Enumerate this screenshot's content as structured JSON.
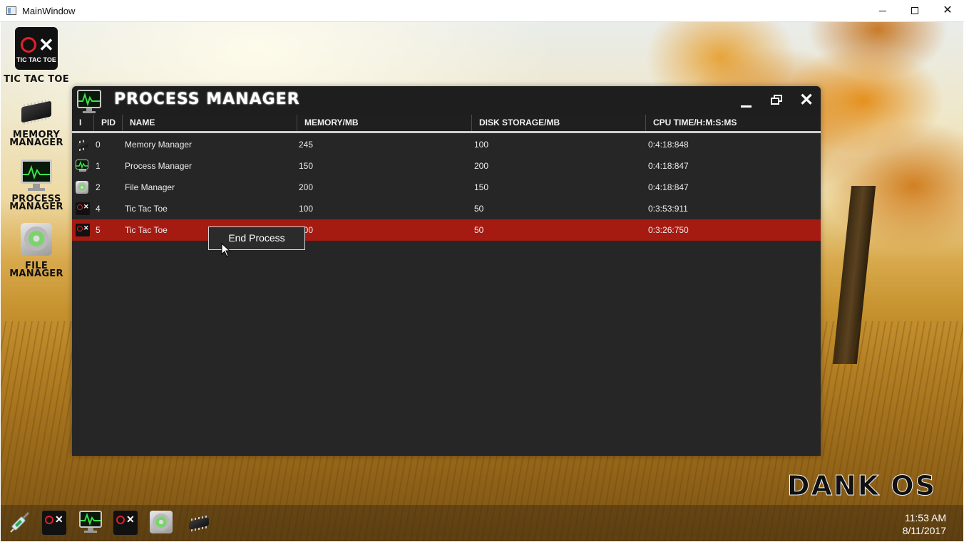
{
  "window": {
    "title": "MainWindow",
    "minimize": "",
    "maximize": "",
    "close": "✕"
  },
  "desktop_icons": {
    "tic_tac_toe": {
      "label": "Tic Tac Toe",
      "logo_text": "TIC TAC TOE"
    },
    "memory_manager": {
      "label_line1": "Memory",
      "label_line2": "Manager"
    },
    "process_manager": {
      "label_line1": "Process",
      "label_line2": "Manager"
    },
    "file_manager": {
      "label_line1": "File",
      "label_line2": "Manager"
    }
  },
  "process_manager": {
    "title": "PROCESS MANAGER",
    "close": "✕",
    "columns": [
      "I",
      "PID",
      "NAME",
      "MEMORY/MB",
      "DISK STORAGE/MB",
      "CPU TIME/H:M:S:MS"
    ],
    "rows": [
      {
        "icon": "memory-chip-icon",
        "pid": "0",
        "name": "Memory Manager",
        "memory": "245",
        "disk": "100",
        "cpu": "0:4:18:848"
      },
      {
        "icon": "process-monitor-icon",
        "pid": "1",
        "name": "Process Manager",
        "memory": "150",
        "disk": "200",
        "cpu": "0:4:18:847"
      },
      {
        "icon": "hard-drive-icon",
        "pid": "2",
        "name": "File Manager",
        "memory": "200",
        "disk": "150",
        "cpu": "0:4:18:847"
      },
      {
        "icon": "tic-tac-toe-icon",
        "pid": "4",
        "name": "Tic Tac Toe",
        "memory": "100",
        "disk": "50",
        "cpu": "0:3:53:911"
      },
      {
        "icon": "tic-tac-toe-icon",
        "pid": "5",
        "name": "Tic Tac Toe",
        "memory": "100",
        "disk": "50",
        "cpu": "0:3:26:750",
        "selected": true
      }
    ],
    "context_menu": {
      "end_process": "End Process"
    }
  },
  "brand": "DANK OS",
  "taskbar": {
    "items": [
      "syringe-icon",
      "tic-tac-toe-icon",
      "process-monitor-icon",
      "tic-tac-toe-icon",
      "hard-drive-icon",
      "memory-chip-icon"
    ],
    "time": "11:53 AM",
    "date": "8/11/2017"
  },
  "colors": {
    "selected_row": "#a51b12",
    "window_bg": "#262626",
    "accent_red": "#e0212b"
  }
}
